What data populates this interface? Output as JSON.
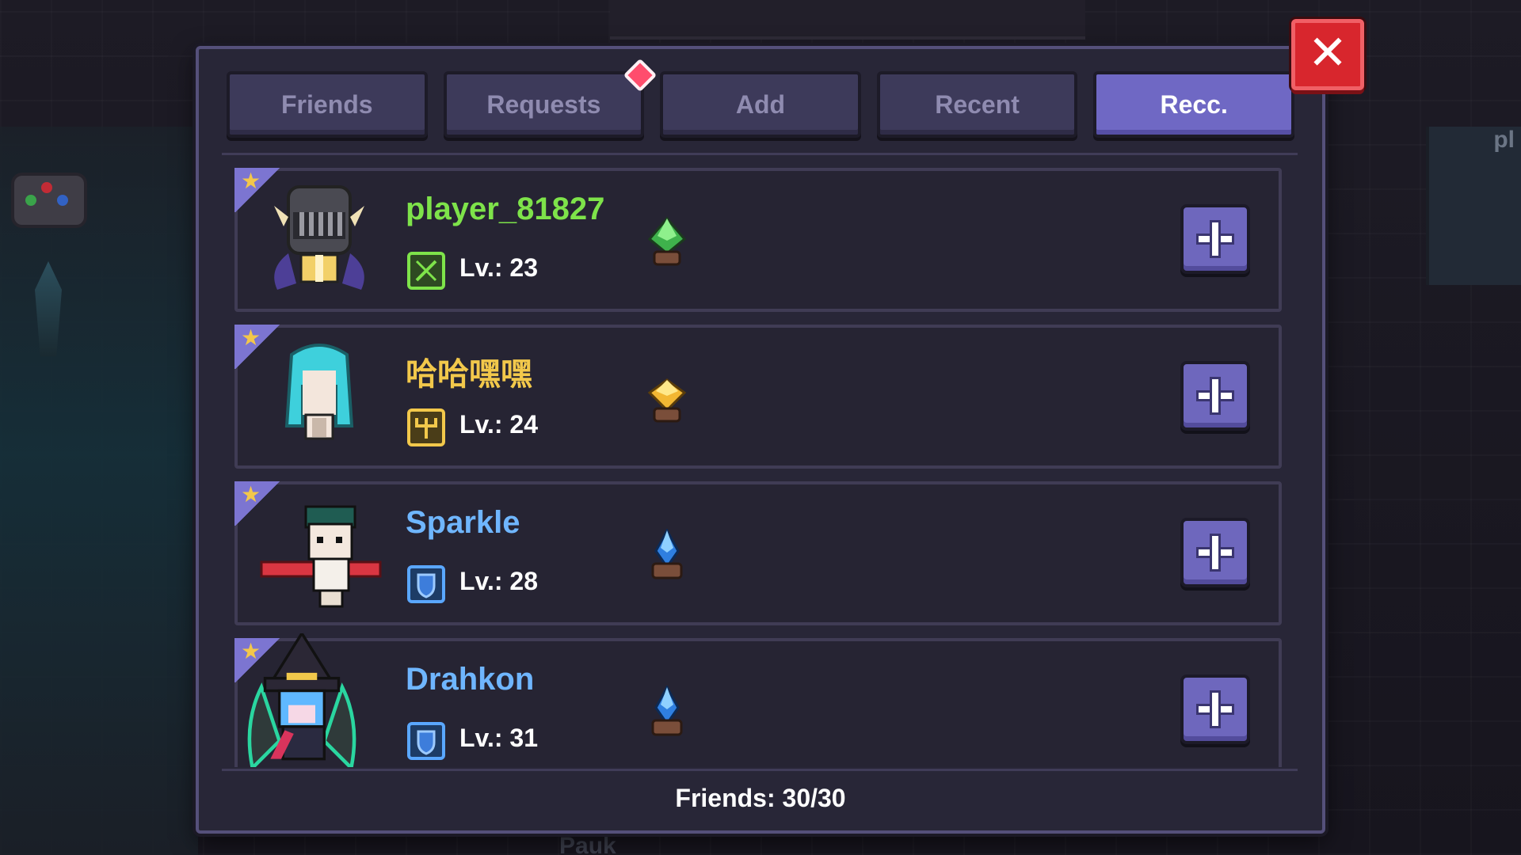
{
  "tabs": [
    {
      "label": "Friends",
      "active": false
    },
    {
      "label": "Requests",
      "active": false,
      "notification": true
    },
    {
      "label": "Add",
      "active": false
    },
    {
      "label": "Recent",
      "active": false
    },
    {
      "label": "Recc.",
      "active": true
    }
  ],
  "players": [
    {
      "name": "player_81827",
      "name_color": "#7ee34a",
      "level_text": "Lv.: 23",
      "class_icon": "sword-icon",
      "class_color": "#7ee34a",
      "rank_gem": "green-gem-icon",
      "avatar": "knight-helmet-avatar"
    },
    {
      "name": "哈哈嘿嘿",
      "name_color": "#f2c84b",
      "level_text": "Lv.: 24",
      "class_icon": "trident-icon",
      "class_color": "#f2c84b",
      "rank_gem": "gold-gem-icon",
      "avatar": "cyan-hair-avatar"
    },
    {
      "name": "Sparkle",
      "name_color": "#6fb6ff",
      "level_text": "Lv.: 28",
      "class_icon": "shield-icon",
      "class_color": "#5aa7ff",
      "rank_gem": "blue-gem-icon",
      "avatar": "swordsman-avatar"
    },
    {
      "name": "Drahkon",
      "name_color": "#6fb6ff",
      "level_text": "Lv.: 31",
      "class_icon": "shield-icon",
      "class_color": "#5aa7ff",
      "rank_gem": "blue-gem-icon",
      "avatar": "witch-hat-avatar"
    }
  ],
  "footer": {
    "friends_count": "Friends: 30/30"
  },
  "close_label": "✕",
  "background": {
    "right_text": "pl",
    "bottom_text": "Pauk"
  }
}
